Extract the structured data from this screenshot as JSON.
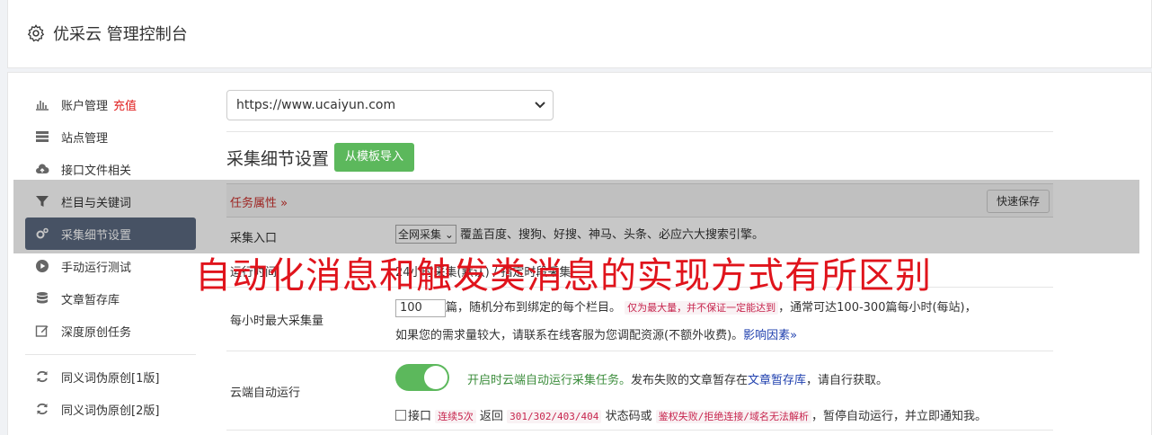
{
  "app": {
    "title": "优采云 管理控制台"
  },
  "sidebar": {
    "items": [
      {
        "label": "账户管理",
        "extra": "充值",
        "icon": "bar-chart-icon"
      },
      {
        "label": "站点管理",
        "icon": "server-icon"
      },
      {
        "label": "接口文件相关",
        "icon": "cloud-upload-icon"
      },
      {
        "label": "栏目与关键词",
        "icon": "filter-icon"
      },
      {
        "label": "采集细节设置",
        "icon": "cogs-icon",
        "active": true
      },
      {
        "label": "手动运行测试",
        "icon": "play-circle-icon"
      },
      {
        "label": "文章暂存库",
        "icon": "database-icon"
      },
      {
        "label": "深度原创任务",
        "icon": "edit-icon"
      },
      {
        "label": "同义词伪原创[1版]",
        "icon": "refresh-icon"
      },
      {
        "label": "同义词伪原创[2版]",
        "icon": "refresh-icon"
      }
    ]
  },
  "main": {
    "site_select": "https://www.ucaiyun.com",
    "section_title": "采集细节设置",
    "import_button": "从模板导入",
    "task_attr": "任务属性",
    "quick_save": "快速保存",
    "entry": {
      "label": "采集入口",
      "select": "全网采集",
      "desc": "覆盖百度、搜狗、好搜、神马、头条、必应六大搜索引擎。"
    },
    "runtime": {
      "label": "运行时间",
      "desc": "24小时采集(默认) / 指定时段采集"
    },
    "max_per_hour": {
      "label": "每小时最大采集量",
      "value": "100",
      "text1": "篇，随机分布到绑定的每个栏目。",
      "code1": "仅为最大量，并不保证一定能达到",
      "text2": "，通常可达100-300篇每小时(每站)，",
      "text3": "如果您的需求量较大，请联系在线客服为您调配资源(不额外收费)。",
      "link": "影响因素»"
    },
    "cloud_run": {
      "label": "云端自动运行",
      "green": "开启时云端自动运行采集任务。",
      "text1": "发布失败的文章暂存在",
      "link": "文章暂存库",
      "text2": "，请自行获取。",
      "check_prefix": "接口",
      "code1": "连续5次",
      "text3": "返回",
      "code2": "301/302/403/404",
      "text4": "状态码或",
      "code3": "鉴权失败/拒绝连接/域名无法解析",
      "text5": "，暂停自动运行，并立即通知我。"
    }
  },
  "banner": "自动化消息和触发类消息的实现方式有所区别",
  "colors": {
    "active_bg": "#5b6a80",
    "green": "#5cb85c",
    "banner_red": "#e0141c"
  }
}
